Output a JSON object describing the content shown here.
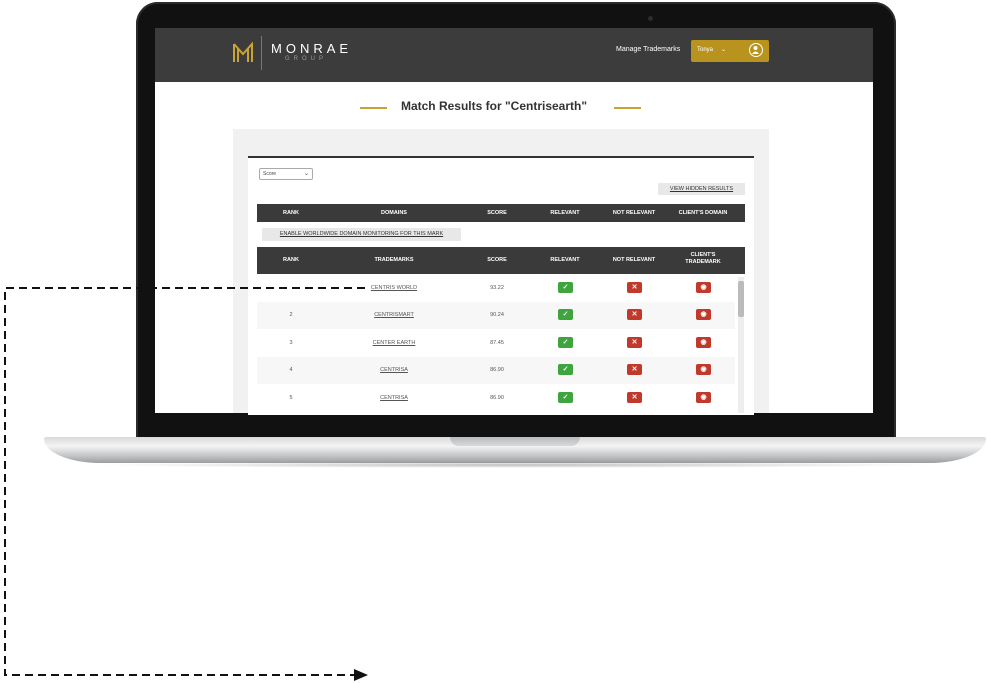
{
  "brand": {
    "name": "MONRAE",
    "sub": "GROUP"
  },
  "nav": {
    "manage_label": "Manage Trademarks",
    "user_name": "Tonya",
    "user_chevron": "⌄"
  },
  "page": {
    "title": "Match Results for \"Centrisearth\""
  },
  "controls": {
    "sort_value": "Score",
    "view_hidden_label": "VIEW HIDDEN RESULTS",
    "enable_monitoring_label": "ENABLE WORLDWIDE DOMAIN MONITORING FOR THIS MARK"
  },
  "domains_table": {
    "headers": [
      "RANK",
      "DOMAINS",
      "SCORE",
      "RELEVANT",
      "NOT RELEVANT",
      "CLIENT'S DOMAIN"
    ]
  },
  "trademarks_table": {
    "headers": [
      "RANK",
      "TRADEMARKS",
      "SCORE",
      "RELEVANT",
      "NOT RELEVANT",
      "CLIENT'S TRADEMARK"
    ],
    "rows": [
      {
        "rank": "",
        "name": "CENTRIS WORLD",
        "score": "93.22"
      },
      {
        "rank": "2",
        "name": "CENTRISMART",
        "score": "90.24"
      },
      {
        "rank": "3",
        "name": "CENTER EARTH",
        "score": "87.45"
      },
      {
        "rank": "4",
        "name": "CENTRISA",
        "score": "86.90"
      },
      {
        "rank": "5",
        "name": "CENTRISA",
        "score": "86.90"
      }
    ]
  },
  "icons": {
    "relevant": "check-icon",
    "not_relevant": "close-icon",
    "client": "eye-icon"
  },
  "colors": {
    "topbar": "#3c3c3c",
    "gold": "#b8941e",
    "green": "#3ea53e",
    "red": "#c0392b"
  }
}
